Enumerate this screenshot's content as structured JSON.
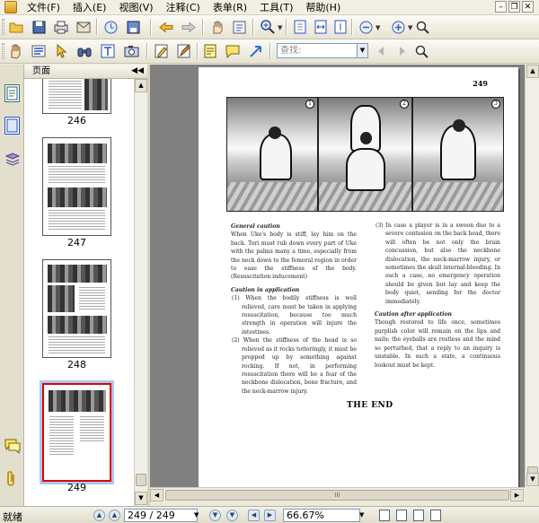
{
  "menu": {
    "items": [
      "文件(F)",
      "插入(E)",
      "视图(V)",
      "注释(C)",
      "表单(R)",
      "工具(T)",
      "帮助(H)"
    ]
  },
  "window_controls": {
    "minimize": "–",
    "restore": "❐",
    "close": "✕"
  },
  "toolbar": {
    "search_placeholder": "查找:",
    "dropdown_arrow": "▼"
  },
  "panel": {
    "title": "页面",
    "collapse": "◀◀",
    "thumbnails": [
      {
        "label": "246",
        "selected": false
      },
      {
        "label": "247",
        "selected": false
      },
      {
        "label": "248",
        "selected": false
      },
      {
        "label": "249",
        "selected": true
      }
    ]
  },
  "document": {
    "page_number": "249",
    "photo_badges": [
      "1",
      "2",
      "3"
    ],
    "left_column": [
      {
        "type": "heading",
        "text": "General caution"
      },
      {
        "type": "para",
        "text": "When Uke's body is stiff, lay him on the back. Tori must rub down every part of Uke with the palms many a time, especially from the neck down to the femoral region in order to ease the stiffness of the body. (Resuscitation inducement)"
      },
      {
        "type": "heading",
        "text": "Caution in application"
      },
      {
        "type": "item",
        "text": "(1) When the bodily stiffness is well relieved, care must be taken in applying resuscitation, because too much strength in operation will injure the intestines."
      },
      {
        "type": "item",
        "text": "(2) When the stiffness of the head is so relieved as it rocks totteringly, it must be propped up by something against rocking. If not, in performing resuscitation there will be a fear of the neckbone dislocation, bone fracture, and the neck-marrow injury."
      }
    ],
    "right_column": [
      {
        "type": "item",
        "text": "(3) In case a player is in a swoon due to a severe contusion on the back head, there will often be not only the brain concussion, but also the neckbone dislocation, the neck-marrow injury, or sometimes the skull internal-bleeding. In such a case, no emergency operation should be given but lay and keep the body quiet, sending for the doctor immediately."
      },
      {
        "type": "heading",
        "text": "Caution after application"
      },
      {
        "type": "para",
        "text": "Though restored to life once, sometimes purplish color will remain on the lips and nails; the eyeballs are restless and the mind so perturbed, that a reply to an inquiry is unstable. In such a state, a continuous lookout must be kept."
      }
    ],
    "the_end": "THE END"
  },
  "scrollbars": {
    "up": "▲",
    "down": "▼",
    "left": "◀",
    "right": "▶",
    "grip": "III"
  },
  "statusbar": {
    "status": "就绪",
    "page_display": "249 / 249",
    "zoom": "66.67%",
    "prev_icon": "◀",
    "next_icon": "▶",
    "first_icon": "▲",
    "last_icon": "▼",
    "dropdown_arrow": "▼"
  }
}
